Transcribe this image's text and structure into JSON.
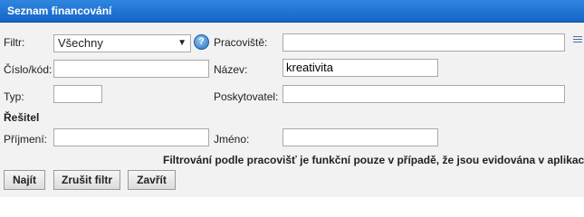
{
  "header": {
    "title": "Seznam financování"
  },
  "form": {
    "filter": {
      "label": "Filtr:",
      "value": "Všechny",
      "help": "?"
    },
    "workplace": {
      "label": "Pracoviště:",
      "value": ""
    },
    "code": {
      "label": "Číslo/kód:",
      "value": ""
    },
    "name": {
      "label": "Název:",
      "value": "kreativita"
    },
    "type": {
      "label": "Typ:",
      "value": ""
    },
    "provider": {
      "label": "Poskytovatel:",
      "value": ""
    },
    "solver_section": "Řešitel",
    "surname": {
      "label": "Příjmení:",
      "value": ""
    },
    "firstname": {
      "label": "Jméno:",
      "value": ""
    },
    "note": "Filtrování podle pracovišť je funkční pouze v případě, že jsou evidována v aplikac"
  },
  "buttons": {
    "find": "Najít",
    "clear": "Zrušit filtr",
    "close": "Zavřít"
  },
  "icons": {
    "help": "help-icon",
    "menu": "menu-list-icon",
    "dropdown": "chevron-down-icon"
  },
  "colors": {
    "header_bg": "#1f77d8",
    "body_bg": "#f2f2f2"
  }
}
